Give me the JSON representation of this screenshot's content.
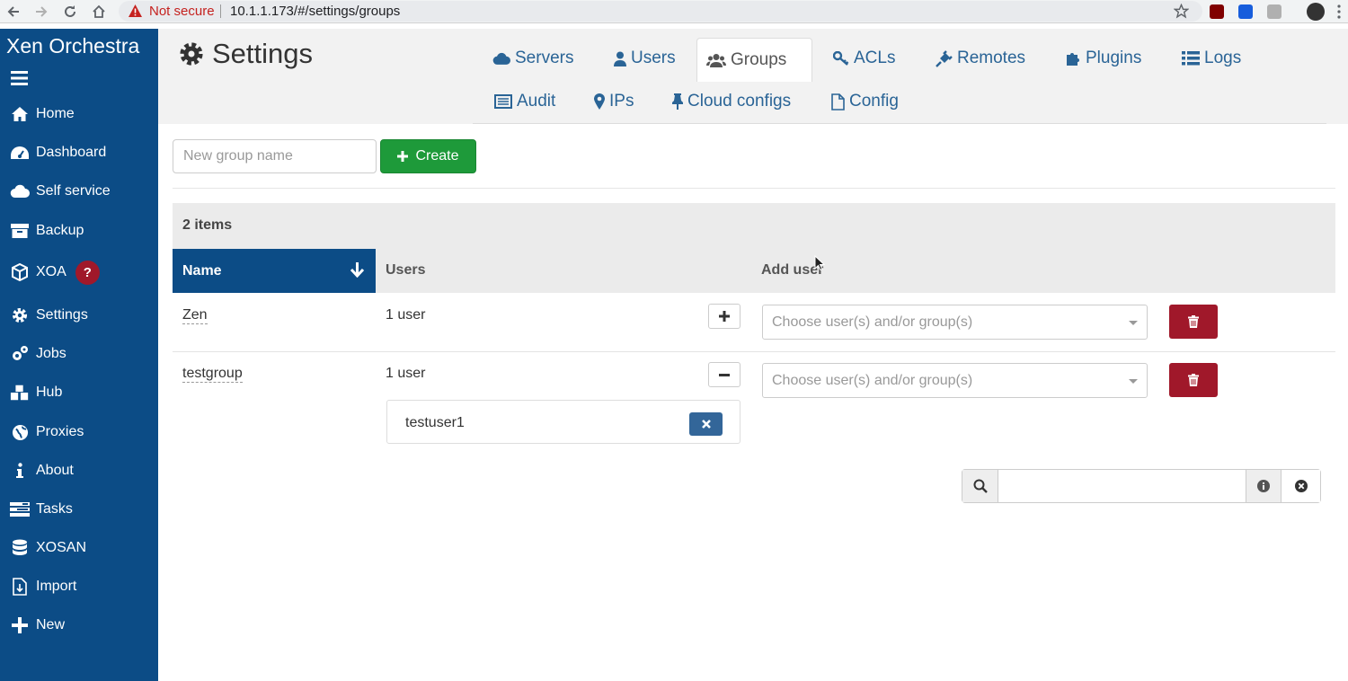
{
  "browser": {
    "security_label": "Not secure",
    "url": "10.1.1.173/#/settings/groups"
  },
  "sidebar": {
    "brand": "Xen Orchestra",
    "items": [
      {
        "label": "Home",
        "icon": "home-icon"
      },
      {
        "label": "Dashboard",
        "icon": "dashboard-icon"
      },
      {
        "label": "Self service",
        "icon": "cloud-icon"
      },
      {
        "label": "Backup",
        "icon": "archive-icon"
      },
      {
        "label": "XOA",
        "icon": "cube-icon",
        "badge": "?"
      },
      {
        "label": "Settings",
        "icon": "gear-icon"
      },
      {
        "label": "Jobs",
        "icon": "gears-icon"
      },
      {
        "label": "Hub",
        "icon": "cubes-icon"
      },
      {
        "label": "Proxies",
        "icon": "globe-icon"
      },
      {
        "label": "About",
        "icon": "info-icon"
      },
      {
        "label": "Tasks",
        "icon": "tasks-icon"
      },
      {
        "label": "XOSAN",
        "icon": "database-icon"
      },
      {
        "label": "Import",
        "icon": "file-import-icon"
      },
      {
        "label": "New",
        "icon": "plus-icon"
      }
    ]
  },
  "header": {
    "title": "Settings",
    "tabs": [
      {
        "label": "Servers",
        "icon": "cloud-icon"
      },
      {
        "label": "Users",
        "icon": "user-icon"
      },
      {
        "label": "Groups",
        "icon": "users-icon",
        "active": true
      },
      {
        "label": "ACLs",
        "icon": "key-icon"
      },
      {
        "label": "Remotes",
        "icon": "plug-icon"
      },
      {
        "label": "Plugins",
        "icon": "puzzle-icon"
      },
      {
        "label": "Logs",
        "icon": "list-icon"
      },
      {
        "label": "Audit",
        "icon": "audit-icon"
      },
      {
        "label": "IPs",
        "icon": "map-marker-icon"
      },
      {
        "label": "Cloud configs",
        "icon": "thumbtack-icon"
      },
      {
        "label": "Config",
        "icon": "file-icon"
      }
    ]
  },
  "create": {
    "placeholder": "New group name",
    "button_label": "Create"
  },
  "table": {
    "item_count": "2 items",
    "columns": {
      "name": "Name",
      "users": "Users",
      "add_user": "Add user"
    },
    "rows": [
      {
        "name": "Zen",
        "users": "1 user",
        "toggle": "+",
        "select_placeholder": "Choose user(s) and/or group(s)",
        "members": []
      },
      {
        "name": "testgroup",
        "users": "1 user",
        "toggle": "−",
        "select_placeholder": "Choose user(s) and/or group(s)",
        "members": [
          "testuser1"
        ]
      }
    ]
  },
  "colors": {
    "sidebar_bg": "#0c4c86",
    "create_green": "#1e9a3a",
    "delete_red": "#a0182a",
    "link_blue": "#2a6496"
  }
}
